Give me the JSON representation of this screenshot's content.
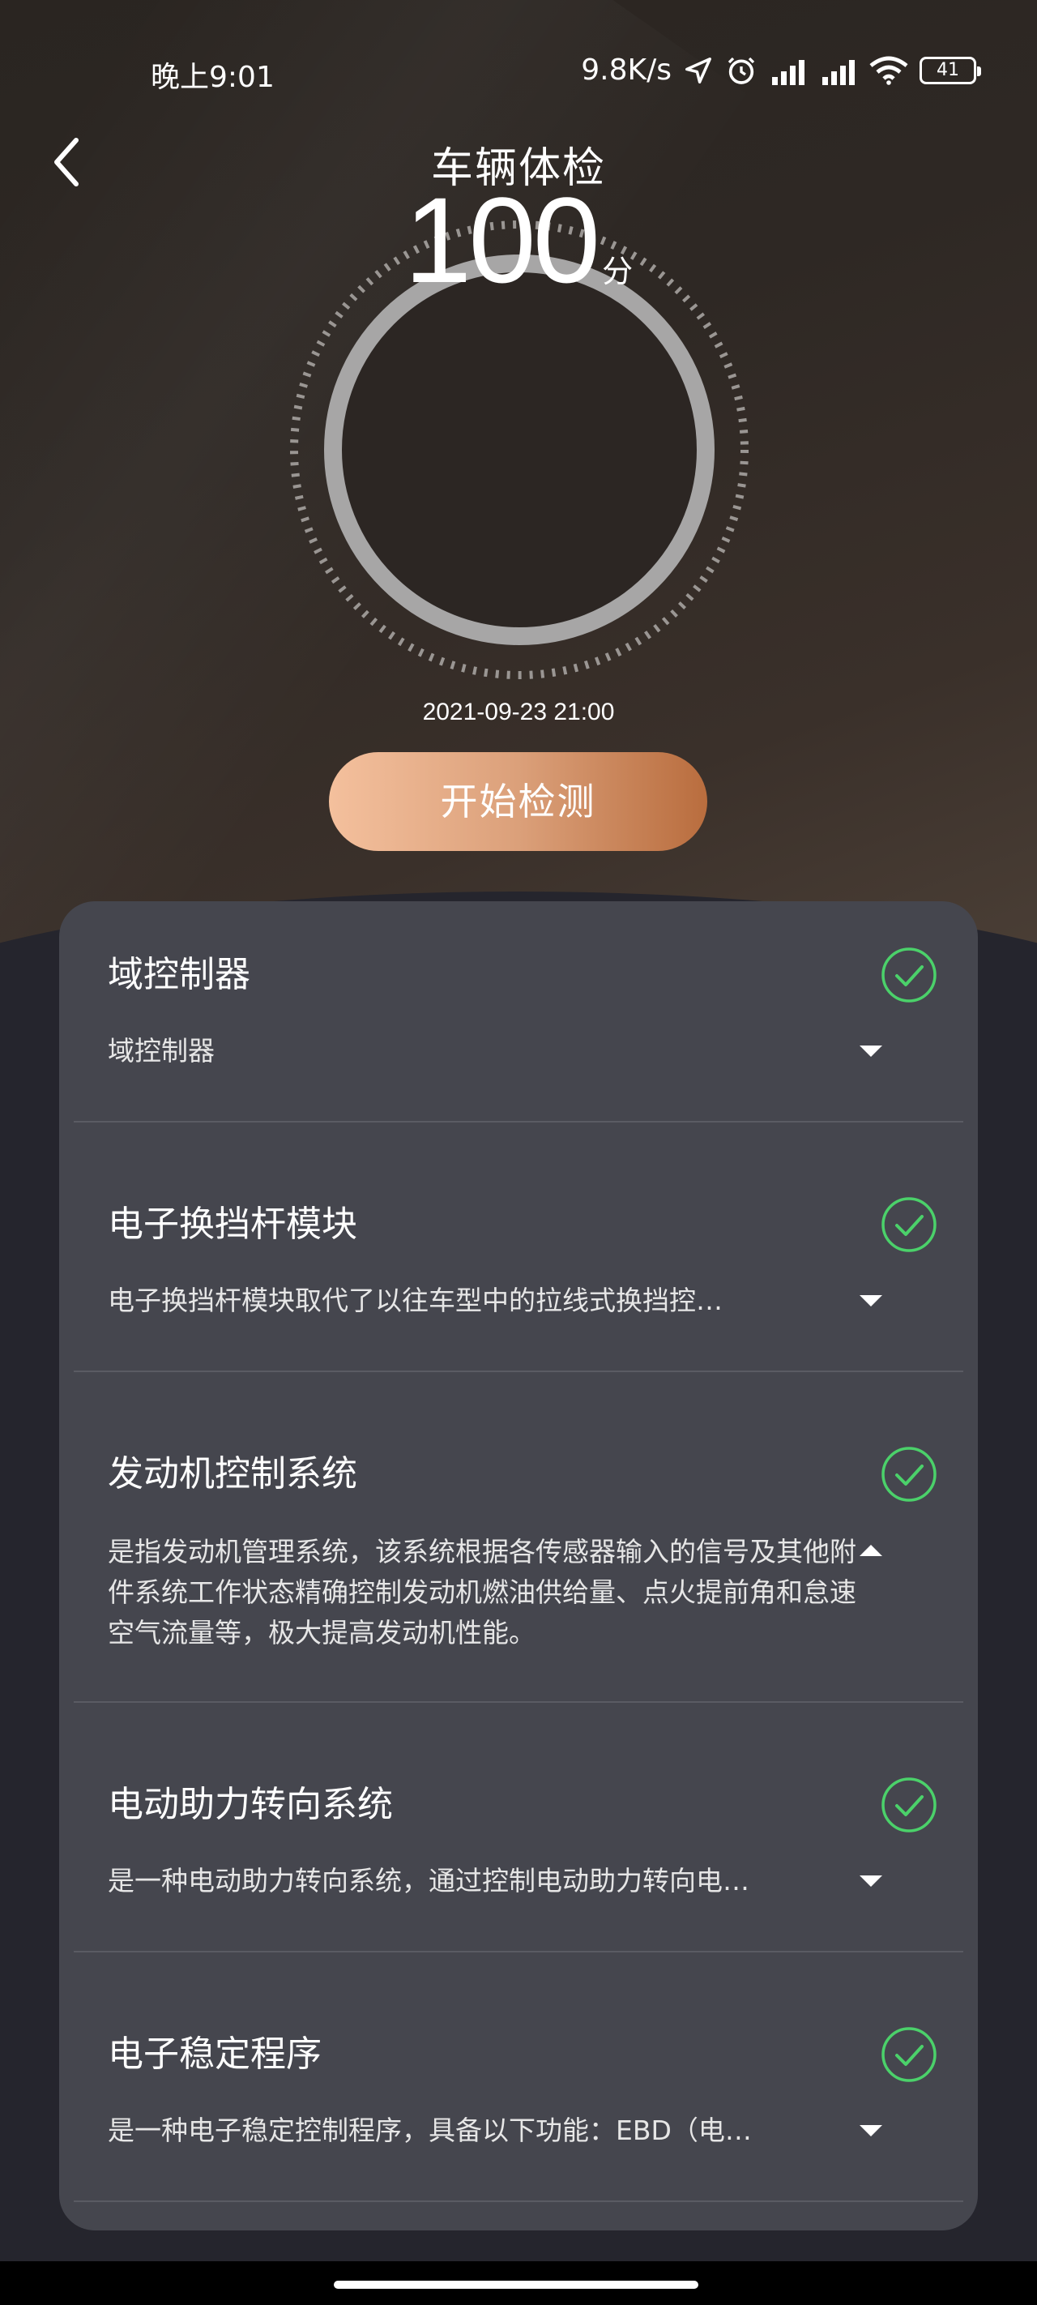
{
  "status_bar": {
    "time": "晚上9:01",
    "net_speed": "9.8K/s",
    "battery": "41",
    "icons": [
      "location-icon",
      "alarm-icon",
      "signal-hd-icon",
      "signal-hd-icon",
      "wifi-icon",
      "battery-icon"
    ]
  },
  "header": {
    "title": "车辆体检",
    "back_icon": "chevron-left-icon"
  },
  "score": {
    "value": "100",
    "unit": "分",
    "progress": 1.0
  },
  "last_check": "2021-09-23 21:00",
  "start_button": "开始检测",
  "colors": {
    "accent_start": "#f4c09d",
    "accent_end": "#b96d3e",
    "ok_green": "#4bd16a",
    "card": "#45464e"
  },
  "items": [
    {
      "name": "域控制器",
      "desc": "域控制器",
      "status": "ok",
      "expanded": false
    },
    {
      "name": "电子换挡杆模块",
      "desc": "电子换挡杆模块取代了以往车型中的拉线式换挡控…",
      "status": "ok",
      "expanded": false
    },
    {
      "name": "发动机控制系统",
      "desc": "是指发动机管理系统，该系统根据各传感器输入的信号及其他附件系统工作状态精确控制发动机燃油供给量、点火提前角和怠速空气流量等，极大提高发动机性能。",
      "status": "ok",
      "expanded": true
    },
    {
      "name": "电动助力转向系统",
      "desc": "是一种电动助力转向系统，通过控制电动助力转向电…",
      "status": "ok",
      "expanded": false
    },
    {
      "name": "电子稳定程序",
      "desc": "是一种电子稳定控制程序，具备以下功能：EBD（电…",
      "status": "ok",
      "expanded": false
    }
  ]
}
